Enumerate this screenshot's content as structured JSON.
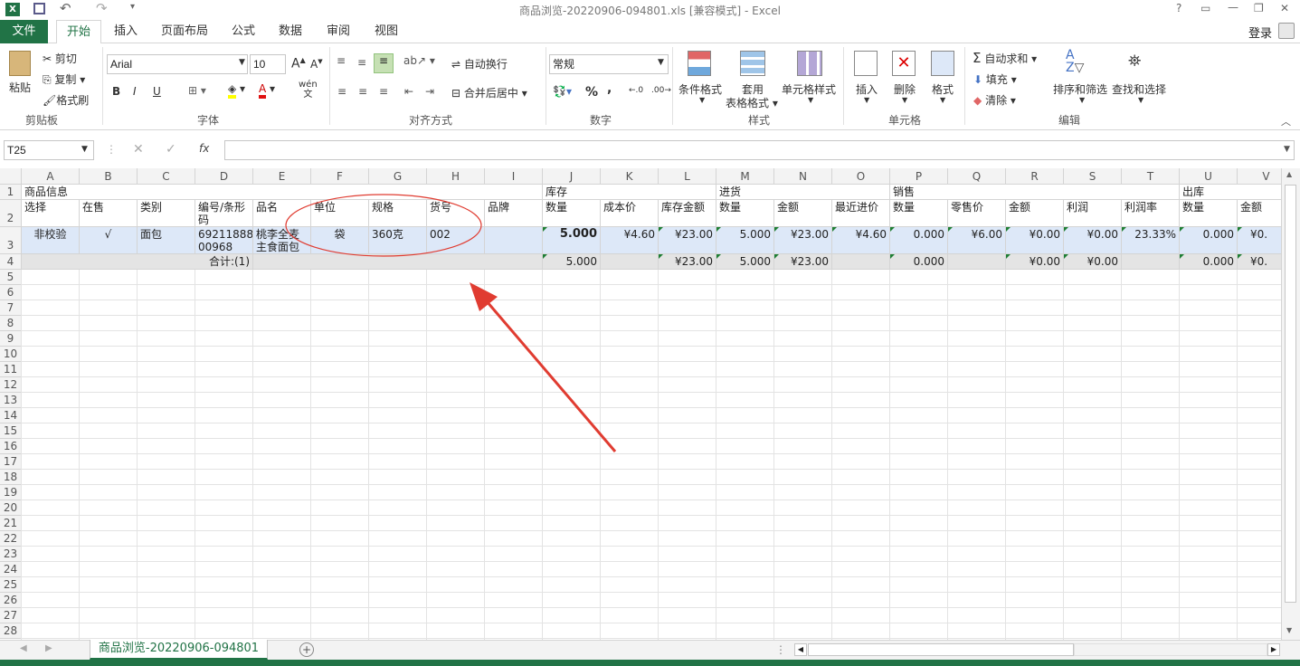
{
  "window": {
    "title": "商品浏览-20220906-094801.xls  [兼容模式] - Excel",
    "controls": [
      "?",
      "▭",
      "—",
      "❐",
      "✕"
    ]
  },
  "qat": {
    "save_icon": "save-icon",
    "undo_icon": "undo-icon",
    "redo_icon": "redo-icon"
  },
  "tabs": [
    {
      "label": "文件"
    },
    {
      "label": "开始"
    },
    {
      "label": "插入"
    },
    {
      "label": "页面布局"
    },
    {
      "label": "公式"
    },
    {
      "label": "数据"
    },
    {
      "label": "审阅"
    },
    {
      "label": "视图"
    }
  ],
  "login": "登录",
  "ribbon": {
    "clipboard": {
      "paste": "粘贴",
      "cut": "剪切",
      "copy": "复制",
      "format_painter": "格式刷",
      "label": "剪贴板"
    },
    "font": {
      "name": "Arial",
      "size": "10",
      "bold": "B",
      "italic": "I",
      "underline": "U",
      "wen": "wén",
      "wen2": "文",
      "label": "字体"
    },
    "alignment": {
      "wrap": "自动换行",
      "merge": "合并后居中",
      "label": "对齐方式"
    },
    "number": {
      "format": "常规",
      "percent": "%",
      "comma": ",",
      "label": "数字"
    },
    "styles": {
      "conditional": "条件格式",
      "table1": "套用",
      "table2": "表格格式",
      "cell_styles": "单元格样式",
      "label": "样式"
    },
    "cells": {
      "insert": "插入",
      "delete": "删除",
      "format": "格式",
      "label": "单元格"
    },
    "editing": {
      "autosum": "自动求和",
      "fill": "填充",
      "clear": "清除",
      "sort": "排序和筛选",
      "find": "查找和选择",
      "label": "编辑"
    }
  },
  "formula_bar": {
    "name_box": "T25",
    "fx": "fx",
    "value": ""
  },
  "columns": [
    "A",
    "B",
    "C",
    "D",
    "E",
    "F",
    "G",
    "H",
    "I",
    "J",
    "K",
    "L",
    "M",
    "N",
    "O",
    "P",
    "Q",
    "R",
    "S",
    "T",
    "U",
    "V"
  ],
  "rows": [
    "1",
    "2",
    "3",
    "4",
    "5",
    "6",
    "7",
    "8",
    "9",
    "10",
    "11",
    "12",
    "13",
    "14",
    "15",
    "16",
    "17",
    "18",
    "19",
    "20",
    "21",
    "22",
    "23",
    "24",
    "25",
    "26",
    "27",
    "28"
  ],
  "row1": {
    "goods": "商品信息",
    "stock": "库存",
    "purchase": "进货",
    "sales": "销售",
    "outbound": "出库"
  },
  "row2": [
    "选择",
    "在售",
    "类别",
    "编号/条形码",
    "品名",
    "单位",
    "规格",
    "货号",
    "品牌",
    "数量",
    "成本价",
    "库存金额",
    "数量",
    "金额",
    "最近进价",
    "数量",
    "零售价",
    "金额",
    "利润",
    "利润率",
    "数量",
    "金额"
  ],
  "row3": {
    "a": "非校验",
    "b": "√",
    "c": "面包",
    "d1": "69211888",
    "d2": "00968",
    "e1": "桃李全麦",
    "e2": "主食面包",
    "f": "袋",
    "g": "360克",
    "h": "002",
    "i": "",
    "j": "5.000",
    "k": "¥4.60",
    "l": "¥23.00",
    "m": "5.000",
    "n": "¥23.00",
    "o": "¥4.60",
    "p": "0.000",
    "q": "¥6.00",
    "r": "¥0.00",
    "s": "¥0.00",
    "t": "23.33%",
    "u": "0.000",
    "v": "¥0."
  },
  "row4": {
    "label": "合计:(1)",
    "j": "5.000",
    "l": "¥23.00",
    "m": "5.000",
    "n": "¥23.00",
    "p": "0.000",
    "r": "¥0.00",
    "s": "¥0.00",
    "u": "0.000",
    "v": "¥0."
  },
  "sheet_tab": "商品浏览-20220906-094801",
  "annotation_color": "#e03c31",
  "accent": "#217346"
}
